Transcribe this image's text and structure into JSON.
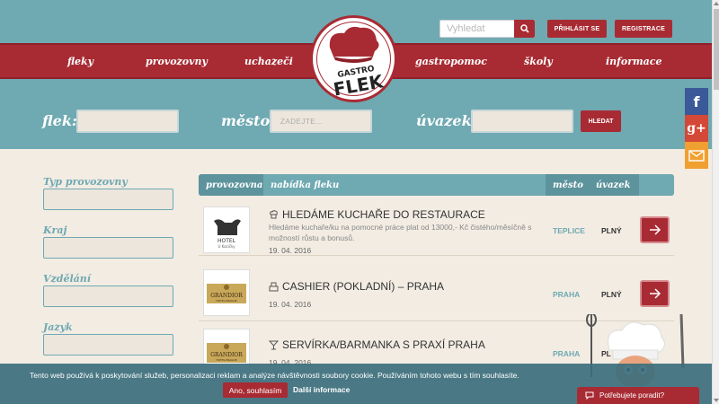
{
  "header": {
    "search_placeholder": "Vyhledat",
    "login_label": "PŘIHLÁSIT SE",
    "register_label": "REGISTRACE"
  },
  "logo": {
    "line1": "GASTRO",
    "line2": "FLEK"
  },
  "nav": {
    "items": [
      {
        "label": "fleky"
      },
      {
        "label": "provozovny"
      },
      {
        "label": "uchazeči"
      },
      {
        "label": "gastropomoc"
      },
      {
        "label": "školy"
      },
      {
        "label": "informace"
      }
    ]
  },
  "filter": {
    "flek_label": "flek:",
    "mesto_label": "město:",
    "mesto_placeholder": "ZADEJTE...",
    "uvazek_label": "úvazek:",
    "submit_label": "HLEDAT"
  },
  "social": {
    "facebook": "f",
    "google": "g+",
    "email_icon": "envelope-icon"
  },
  "sidebar": {
    "fields": [
      {
        "label": "Typ provozovny"
      },
      {
        "label": "Kraj"
      },
      {
        "label": "Vzdělání"
      },
      {
        "label": "Jazyk"
      }
    ]
  },
  "table": {
    "headers": {
      "provozovna": "provozovna",
      "nabidka": "nabídka fleku",
      "mesto": "město",
      "uvazek": "úvazek"
    },
    "rows": [
      {
        "logo_text": "HOTEL",
        "logo_sub": "U Kozičky",
        "title": "HLEDÁME KUCHAŘE DO RESTAURACE",
        "description": "Hledáme kuchaře/ku na pomocné práce plat od 13000,- Kč čistého/měsíčně s možností růstu a bonusů.",
        "date": "19. 04. 2016",
        "city": "TEPLICE",
        "type": "PLNÝ",
        "icon": "chef-icon"
      },
      {
        "logo_text": "GRANDIOR",
        "logo_sub": "HOTEL PRAGUE",
        "title": "CASHIER (POKLADNÍ) – PRAHA",
        "description": "",
        "date": "19. 04. 2016",
        "city": "PRAHA",
        "type": "PLNÝ",
        "icon": "cashier-icon"
      },
      {
        "logo_text": "GRANDIOR",
        "logo_sub": "HOTEL PRAGUE",
        "title": "SERVÍRKA/BARMANKA S PRAXÍ PRAHA",
        "description": "",
        "date": "19. 04. 2016",
        "city": "PRAHA",
        "type": "PL",
        "icon": "cocktail-icon"
      }
    ]
  },
  "cookie": {
    "text": "Tento web používá k poskytování služeb, personalizaci reklam a analýze návštěvnosti soubory cookie. Používáním tohoto webu s tím souhlasíte.",
    "accept_label": "Ano, souhlasím",
    "more_label": "Další informace"
  },
  "help": {
    "label": "Potřebujete poradit?"
  }
}
